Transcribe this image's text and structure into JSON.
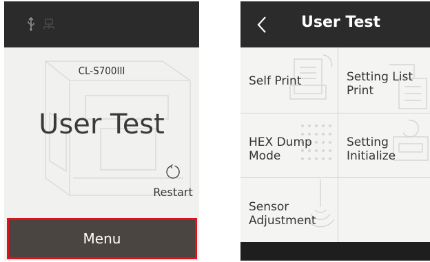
{
  "left_screen": {
    "model": "CL-S700III",
    "title": "User Test",
    "restart_label": "Restart",
    "menu_label": "Menu",
    "status_icons": [
      "usb-icon",
      "network-icon"
    ],
    "colors": {
      "topbar": "#2b2b2b",
      "menu_button": "#4b4542",
      "highlight_border": "#e0111b"
    }
  },
  "right_screen": {
    "title": "User Test",
    "items": [
      {
        "line1": "Self Print",
        "line2": "",
        "icon": "print-doc-icon"
      },
      {
        "line1": "Setting List",
        "line2": "Print",
        "icon": "list-print-icon"
      },
      {
        "line1": "HEX Dump",
        "line2": "Mode",
        "icon": "dot-grid-icon"
      },
      {
        "line1": "Setting",
        "line2": "Initialize",
        "icon": "printer-reset-icon"
      },
      {
        "line1": "Sensor",
        "line2": "Adjustment",
        "icon": "sensor-icon"
      }
    ]
  }
}
